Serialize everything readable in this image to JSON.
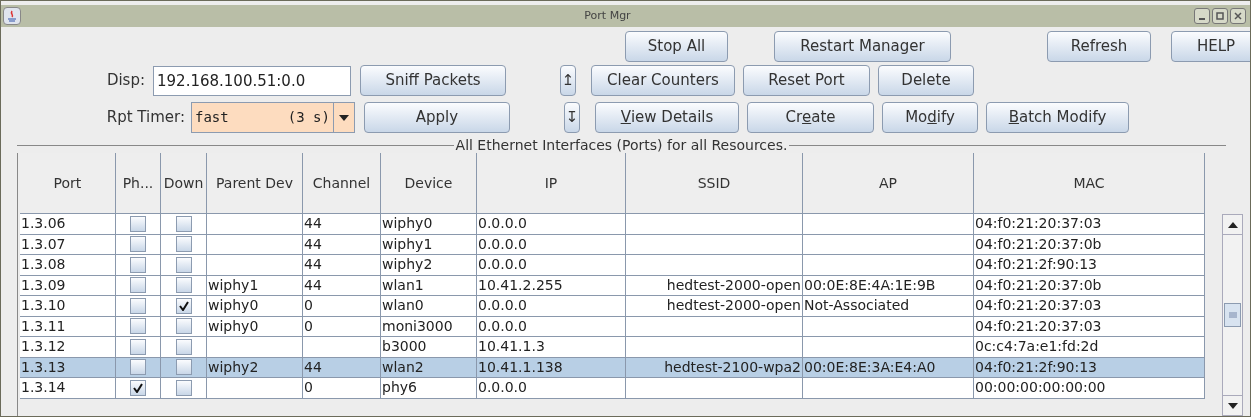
{
  "window": {
    "title": "Port Mgr"
  },
  "toolbar": {
    "disp_label": "Disp:",
    "disp_value": "192.168.100.51:0.0",
    "timer_label": "Rpt Timer:",
    "timer_value": "fast       (3 s)",
    "sniff": "Sniff Packets",
    "apply": "Apply",
    "up": "↥",
    "down": "↧",
    "row1": [
      {
        "label": "Stop All"
      },
      {
        "label": "Restart Manager"
      },
      {
        "label": "Refresh"
      },
      {
        "label": "HELP"
      }
    ],
    "row2": [
      {
        "label": "Clear Counters"
      },
      {
        "label": "Reset Port"
      },
      {
        "label": "Delete"
      }
    ],
    "row3": [
      {
        "mnemonic": "V",
        "after": "iew Details"
      },
      {
        "before": "Cr",
        "mnemonic": "e",
        "after": "ate"
      },
      {
        "before": "Mo",
        "mnemonic": "d",
        "after": "ify"
      },
      {
        "mnemonic": "B",
        "after": "atch Modify"
      }
    ]
  },
  "table": {
    "title": "All Ethernet Interfaces (Ports) for all Resources.",
    "columns": [
      "Port",
      "Ph...",
      "Down",
      "Parent Dev",
      "Channel",
      "Device",
      "IP",
      "SSID",
      "AP",
      "MAC"
    ],
    "rows": [
      {
        "port": "1.3.06",
        "ph": false,
        "down": false,
        "parent": "",
        "channel": "44",
        "device": "wiphy0",
        "ip": "0.0.0.0",
        "ssid": "",
        "ap": "",
        "mac": "04:f0:21:20:37:03",
        "selected": false
      },
      {
        "port": "1.3.07",
        "ph": false,
        "down": false,
        "parent": "",
        "channel": "44",
        "device": "wiphy1",
        "ip": "0.0.0.0",
        "ssid": "",
        "ap": "",
        "mac": "04:f0:21:20:37:0b",
        "selected": false
      },
      {
        "port": "1.3.08",
        "ph": false,
        "down": false,
        "parent": "",
        "channel": "44",
        "device": "wiphy2",
        "ip": "0.0.0.0",
        "ssid": "",
        "ap": "",
        "mac": "04:f0:21:2f:90:13",
        "selected": false
      },
      {
        "port": "1.3.09",
        "ph": false,
        "down": false,
        "parent": "wiphy1",
        "channel": "44",
        "device": "wlan1",
        "ip": "10.41.2.255",
        "ssid": "hedtest-2000-open",
        "ap": "00:0E:8E:4A:1E:9B",
        "mac": "04:f0:21:20:37:0b",
        "selected": false
      },
      {
        "port": "1.3.10",
        "ph": false,
        "down": true,
        "parent": "wiphy0",
        "channel": "0",
        "device": "wlan0",
        "ip": "0.0.0.0",
        "ssid": "hedtest-2000-open",
        "ap": "Not-Associated",
        "mac": "04:f0:21:20:37:03",
        "selected": false
      },
      {
        "port": "1.3.11",
        "ph": false,
        "down": false,
        "parent": "wiphy0",
        "channel": "0",
        "device": "moni3000",
        "ip": "0.0.0.0",
        "ssid": "",
        "ap": "",
        "mac": "04:f0:21:20:37:03",
        "selected": false
      },
      {
        "port": "1.3.12",
        "ph": false,
        "down": false,
        "parent": "",
        "channel": "",
        "device": "b3000",
        "ip": "10.41.1.3",
        "ssid": "",
        "ap": "",
        "mac": "0c:c4:7a:e1:fd:2d",
        "selected": false
      },
      {
        "port": "1.3.13",
        "ph": false,
        "down": false,
        "parent": "wiphy2",
        "channel": "44",
        "device": "wlan2",
        "ip": "10.41.1.138",
        "ssid": "hedtest-2100-wpa2",
        "ap": "00:0E:8E:3A:E4:A0",
        "mac": "04:f0:21:2f:90:13",
        "selected": true
      },
      {
        "port": "1.3.14",
        "ph": true,
        "down": false,
        "parent": "",
        "channel": "0",
        "device": "phy6",
        "ip": "0.0.0.0",
        "ssid": "",
        "ap": "",
        "mac": "00:00:00:00:00:00",
        "selected": false
      }
    ]
  }
}
